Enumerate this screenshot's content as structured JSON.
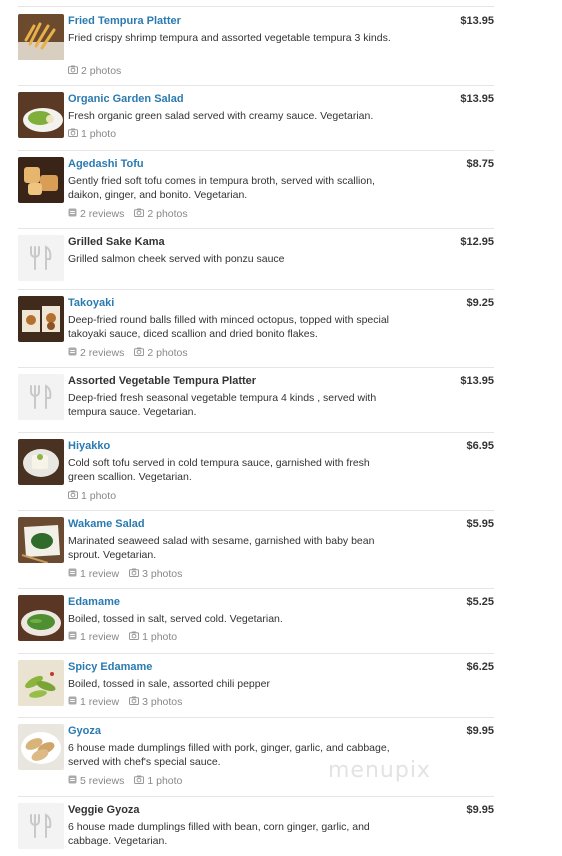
{
  "colors": {
    "link": "#2a7ab0",
    "text": "#333333",
    "muted": "#888888",
    "divider": "#e6e6e6"
  },
  "watermark": "menupix",
  "items": [
    {
      "name": "Fried Tempura Platter",
      "price": "$13.95",
      "desc": "Fried crispy shrimp tempura and assorted vegetable tempura 3 kinds.",
      "photos": "2 photos",
      "reviews": null,
      "thumb": "tempura-photo",
      "link": true
    },
    {
      "name": "Organic Garden Salad",
      "price": "$13.95",
      "desc": "Fresh organic green salad served with creamy sauce. Vegetarian.",
      "photos": "1 photo",
      "reviews": null,
      "thumb": "salad-photo",
      "link": true
    },
    {
      "name": "Agedashi Tofu",
      "price": "$8.75",
      "desc": "Gently fried soft tofu comes in tempura broth, served with scallion, daikon, ginger, and bonito. Vegetarian.",
      "photos": "2 photos",
      "reviews": "2 reviews",
      "thumb": "tofu-photo",
      "link": true
    },
    {
      "name": "Grilled Sake Kama",
      "price": "$12.95",
      "desc": "Grilled salmon cheek served with ponzu sauce",
      "photos": null,
      "reviews": null,
      "thumb": "utensils-placeholder-icon",
      "link": false
    },
    {
      "name": "Takoyaki",
      "price": "$9.25",
      "desc": "Deep-fried round balls filled with minced octopus, topped with special takoyaki sauce, diced scallion and dried bonito flakes.",
      "photos": "2 photos",
      "reviews": "2 reviews",
      "thumb": "takoyaki-photo",
      "link": true
    },
    {
      "name": "Assorted Vegetable Tempura Platter",
      "price": "$13.95",
      "desc": "Deep-fried fresh seasonal vegetable tempura 4 kinds , served with tempura sauce. Vegetarian.",
      "photos": null,
      "reviews": null,
      "thumb": "utensils-placeholder-icon",
      "link": false
    },
    {
      "name": "Hiyakko",
      "price": "$6.95",
      "desc": "Cold soft tofu served in cold tempura sauce, garnished with fresh green scallion. Vegetarian.",
      "photos": "1 photo",
      "reviews": null,
      "thumb": "hiyakko-photo",
      "link": true
    },
    {
      "name": "Wakame Salad",
      "price": "$5.95",
      "desc": "Marinated seaweed salad with sesame, garnished with baby bean sprout. Vegetarian.",
      "photos": "3 photos",
      "reviews": "1 review",
      "thumb": "wakame-photo",
      "link": true
    },
    {
      "name": "Edamame",
      "price": "$5.25",
      "desc": "Boiled, tossed in salt, served cold. Vegetarian.",
      "photos": "1 photo",
      "reviews": "1 review",
      "thumb": "edamame-photo",
      "link": true
    },
    {
      "name": "Spicy Edamame",
      "price": "$6.25",
      "desc": "Boiled, tossed in sale, assorted chili pepper",
      "photos": "3 photos",
      "reviews": "1 review",
      "thumb": "spicy-edamame-photo",
      "link": true
    },
    {
      "name": "Gyoza",
      "price": "$9.95",
      "desc": "6 house made dumplings filled with pork, ginger, garlic, and cabbage, served with chef's special sauce.",
      "photos": "1 photo",
      "reviews": "5 reviews",
      "thumb": "gyoza-photo",
      "link": true
    },
    {
      "name": "Veggie Gyoza",
      "price": "$9.95",
      "desc": "6 house made dumplings filled with bean, corn ginger, garlic, and cabbage. Vegetarian.",
      "photos": null,
      "reviews": null,
      "thumb": "utensils-placeholder-icon",
      "link": false
    }
  ]
}
